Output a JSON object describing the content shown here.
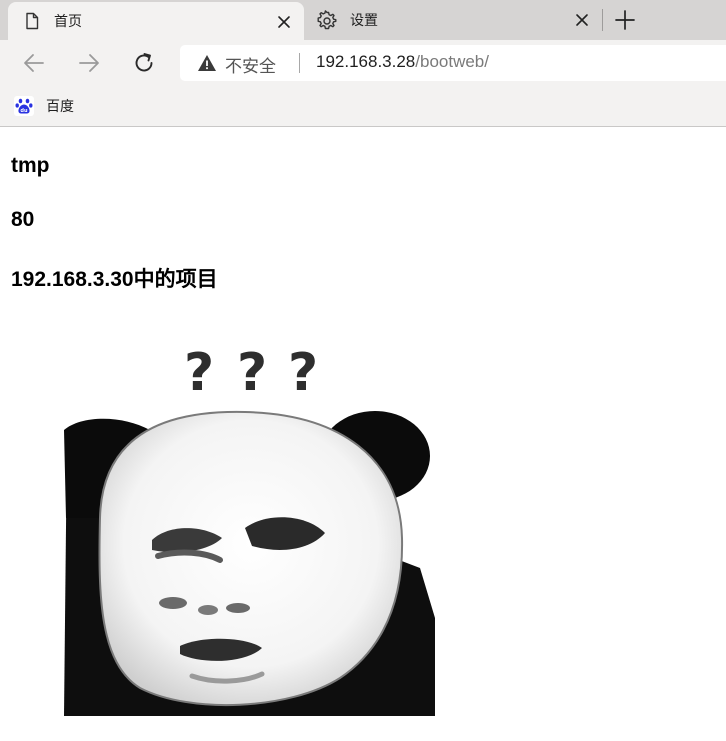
{
  "browser": {
    "tabs": [
      {
        "title": "首页",
        "icon": "page-icon",
        "active": true
      },
      {
        "title": "设置",
        "icon": "gear-icon",
        "active": false
      }
    ],
    "address_bar": {
      "security_label": "不安全",
      "url_host": "192.168.3.28",
      "url_path": "/bootweb/"
    },
    "favorites": [
      {
        "label": "百度",
        "icon": "baidu-paw-icon"
      }
    ]
  },
  "page": {
    "headings": [
      "tmp",
      "80",
      "192.168.3.30中的项目"
    ],
    "image": {
      "caption_glyphs": "？？？",
      "subject": "panda-meme-face"
    }
  },
  "colors": {
    "tabstrip": "#d6d4d3",
    "toolbar": "#f3f2f1",
    "baidu_blue": "#2932e1"
  }
}
